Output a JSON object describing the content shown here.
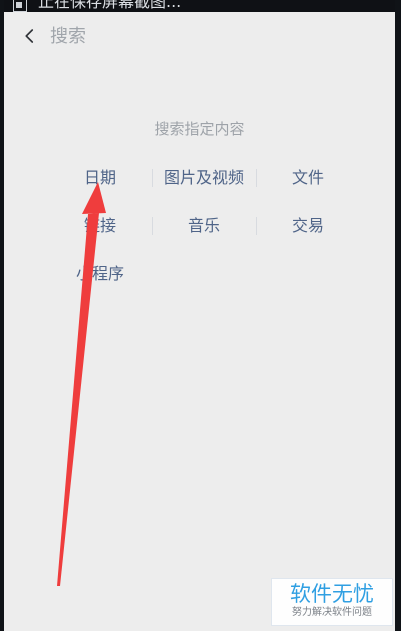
{
  "status_bar": {
    "text": "止在保存屏幕截图..."
  },
  "header": {
    "search_placeholder": "搜索"
  },
  "section": {
    "title": "搜索指定内容"
  },
  "categories": [
    "日期",
    "图片及视频",
    "文件",
    "链接",
    "音乐",
    "交易",
    "小程序"
  ],
  "watermark": {
    "title": "软件无忧",
    "subtitle": "努力解决软件问题"
  },
  "colors": {
    "arrow": "#ef3d3d",
    "link": "#4f6488"
  },
  "icons": {
    "back": "chevron-left-icon",
    "status": "screenshot-icon"
  }
}
